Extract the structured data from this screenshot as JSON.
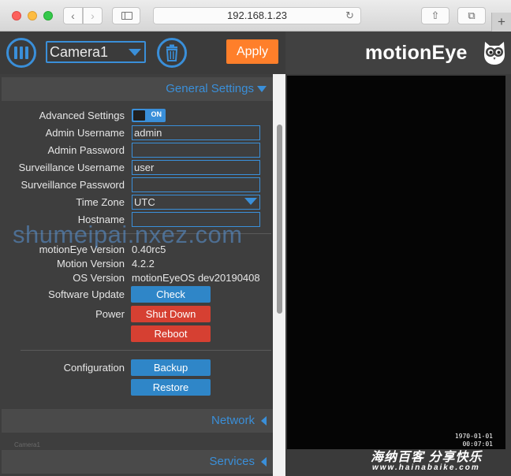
{
  "browser": {
    "url": "192.168.1.23",
    "back_glyph": "‹",
    "forward_glyph": "›",
    "reload_glyph": "↻",
    "share_glyph": "⇧",
    "tabs_glyph": "⧉",
    "new_tab_glyph": "+"
  },
  "header": {
    "camera_name": "Camera1",
    "apply_label": "Apply",
    "brand": "motionEye"
  },
  "sections": {
    "general": "General Settings",
    "network": "Network",
    "services": "Services"
  },
  "general": {
    "advanced_settings_label": "Advanced Settings",
    "advanced_settings_toggle": "ON",
    "admin_username_label": "Admin Username",
    "admin_username_value": "admin",
    "admin_password_label": "Admin Password",
    "admin_password_value": "",
    "surveillance_username_label": "Surveillance Username",
    "surveillance_username_value": "user",
    "surveillance_password_label": "Surveillance Password",
    "surveillance_password_value": "",
    "time_zone_label": "Time Zone",
    "time_zone_value": "UTC",
    "hostname_label": "Hostname",
    "hostname_value": "",
    "motioneye_version_label": "motionEye Version",
    "motioneye_version_value": "0.40rc5",
    "motion_version_label": "Motion Version",
    "motion_version_value": "4.2.2",
    "os_version_label": "OS Version",
    "os_version_value": "motionEyeOS dev20190408",
    "software_update_label": "Software Update",
    "check_button": "Check",
    "power_label": "Power",
    "shutdown_button": "Shut Down",
    "reboot_button": "Reboot",
    "configuration_label": "Configuration",
    "backup_button": "Backup",
    "restore_button": "Restore"
  },
  "overlay": {
    "watermark": "shumeipai.nxez.com",
    "camera_label": "Camera1"
  },
  "video": {
    "date": "1970-01-01",
    "time": "00:07:01"
  },
  "site_watermark": {
    "name": "海纳百客 分享快乐",
    "url": "www.hainabaike.com"
  },
  "colors": {
    "accent": "#3a8fd9",
    "apply": "#ff7f2a",
    "danger": "#d64032",
    "panel": "#3e3e3e"
  }
}
